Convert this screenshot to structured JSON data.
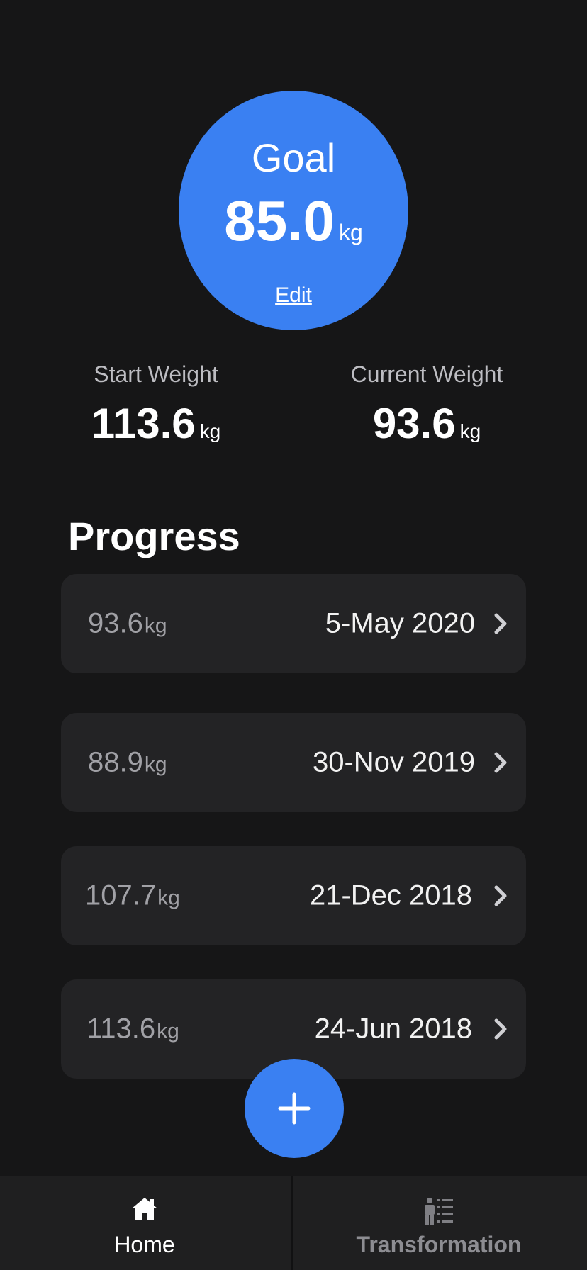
{
  "goal": {
    "label": "Goal",
    "value": "85.0",
    "unit": "kg",
    "edit_label": "Edit"
  },
  "stats": {
    "start": {
      "label": "Start Weight",
      "value": "113.6",
      "unit": "kg"
    },
    "current": {
      "label": "Current Weight",
      "value": "93.6",
      "unit": "kg"
    }
  },
  "progress": {
    "title": "Progress",
    "entries": [
      {
        "weight": "93.6",
        "unit": "kg",
        "date": "5-May 2020"
      },
      {
        "weight": "88.9",
        "unit": "kg",
        "date": "30-Nov 2019"
      },
      {
        "weight": "107.7",
        "unit": "kg",
        "date": "21-Dec 2018"
      },
      {
        "weight": "113.6",
        "unit": "kg",
        "date": "24-Jun 2018"
      }
    ]
  },
  "fab": {
    "icon": "plus-icon"
  },
  "tabs": [
    {
      "label": "Home",
      "icon": "home-icon",
      "active": true
    },
    {
      "label": "Transformation",
      "icon": "transformation-icon",
      "active": false
    }
  ],
  "colors": {
    "background": "#161617",
    "accent": "#3a80f2",
    "card": "#232325",
    "tabbar": "#1f1f20",
    "muted_text": "#a1a1a6"
  }
}
